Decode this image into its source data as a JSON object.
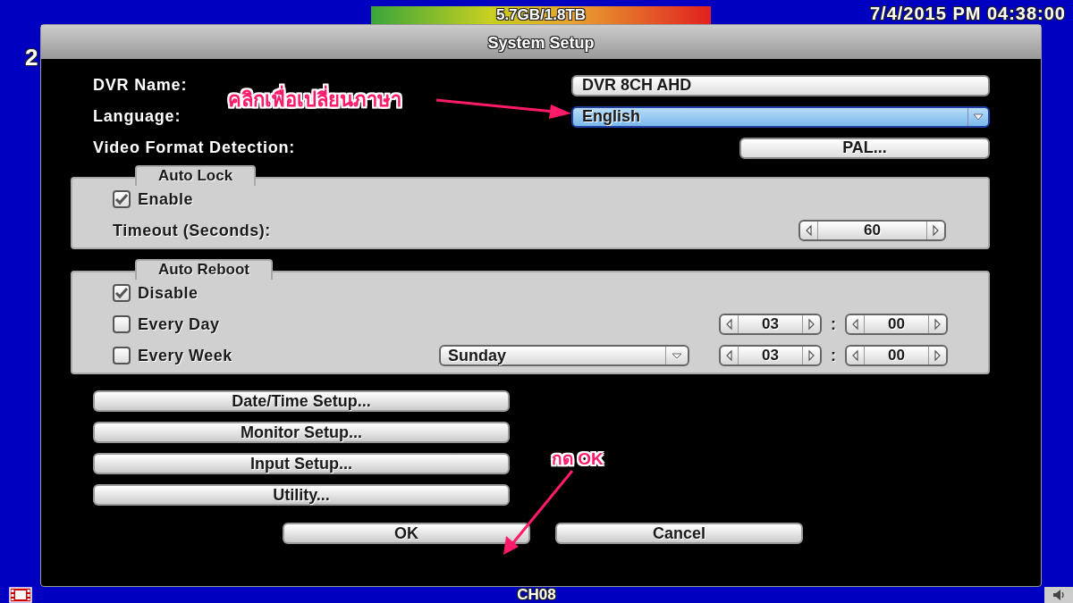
{
  "status_bar": {
    "left_text": "2",
    "storage": "5.7GB/1.8TB",
    "datetime": "7/4/2015 PM 04:38:00"
  },
  "dialog": {
    "title": "System Setup",
    "fields": [
      {
        "kind": "text",
        "label": "DVR Name:",
        "value": "DVR 8CH AHD",
        "focused": false
      },
      {
        "kind": "dropdown",
        "label": "Language:",
        "value": "English",
        "focused": true
      },
      {
        "kind": "button",
        "label": "Video Format Detection:",
        "value": "PAL...",
        "focused": false
      }
    ],
    "auto_lock": {
      "title": "Auto Lock",
      "enable": {
        "label": "Enable",
        "checked": true
      },
      "timeout": {
        "label": "Timeout (Seconds):",
        "value": "60"
      }
    },
    "auto_reboot": {
      "title": "Auto Reboot",
      "options": [
        {
          "kind": "plain",
          "label": "Disable",
          "checked": true
        },
        {
          "kind": "daily",
          "label": "Every Day",
          "checked": false,
          "hour": "03",
          "separator": ":",
          "minute": "00"
        },
        {
          "kind": "weekly",
          "label": "Every Week",
          "checked": false,
          "day": "Sunday",
          "hour": "03",
          "separator": ":",
          "minute": "00"
        }
      ]
    },
    "menu_buttons": [
      "Date/Time Setup...",
      "Monitor Setup...",
      "Input Setup...",
      "Utility..."
    ],
    "buttons": [
      "OK",
      "Cancel"
    ]
  },
  "bottom_bar": {
    "channel": "CH08"
  },
  "annotations": [
    {
      "text": "คลิกเพื่อเปลี่ยนภาษา"
    },
    {
      "text": "กด OK"
    }
  ]
}
